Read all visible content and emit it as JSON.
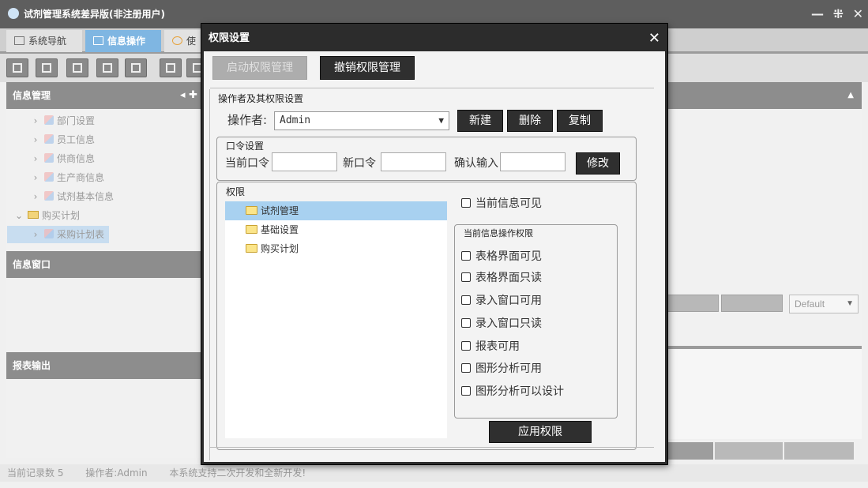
{
  "app": {
    "title": "试剂管理系统差异版(非注册用户)",
    "window_controls": {
      "minimize": "—",
      "maximize": "⁜",
      "close": "✕"
    },
    "tabs": [
      {
        "label": "系统导航"
      },
      {
        "label": "信息操作"
      },
      {
        "label": "使"
      }
    ]
  },
  "sidebar": {
    "info_panel": {
      "title": "信息管理",
      "controls": "◂ ✚",
      "tree": [
        {
          "label": "部门设置"
        },
        {
          "label": "员工信息"
        },
        {
          "label": "供商信息"
        },
        {
          "label": "生产商信息"
        },
        {
          "label": "试剂基本信息"
        },
        {
          "label": "购买计划"
        },
        {
          "label": "采购计划表"
        }
      ]
    },
    "window_panel": {
      "title": "信息窗口"
    },
    "report_panel": {
      "title": "报表输出"
    }
  },
  "background_right": {
    "default_select": "Default"
  },
  "statusbar": {
    "record_count": "当前记录数 5",
    "operator": "操作者:Admin",
    "note": "本系统支持二次开发和全新开发!"
  },
  "dialog": {
    "title": "权限设置",
    "close_glyph": "✕",
    "enable_button": "启动权限管理",
    "revoke_button": "撤销权限管理",
    "operator_section_label": "操作者及其权限设置",
    "operator_label": "操作者:",
    "operator_value": "Admin",
    "new_button": "新建",
    "delete_button": "删除",
    "copy_button": "复制",
    "password_section_label": "口令设置",
    "current_password_label": "当前口令",
    "new_password_label": "新口令",
    "confirm_password_label": "确认输入",
    "modify_button": "修改",
    "permission_section_label": "权限",
    "permission_tree": [
      {
        "label": "试剂管理",
        "selected": true
      },
      {
        "label": "基础设置",
        "selected": false
      },
      {
        "label": "购买计划",
        "selected": false
      }
    ],
    "current_info_visible": "当前信息可见",
    "ops_section_label": "当前信息操作权限",
    "ops_checkboxes": [
      {
        "label": "表格界面可见"
      },
      {
        "label": "表格界面只读"
      },
      {
        "label": "录入窗口可用"
      },
      {
        "label": "录入窗口只读"
      },
      {
        "label": "报表可用"
      },
      {
        "label": "图形分析可用"
      },
      {
        "label": "图形分析可以设计"
      }
    ],
    "apply_button": "应用权限"
  }
}
